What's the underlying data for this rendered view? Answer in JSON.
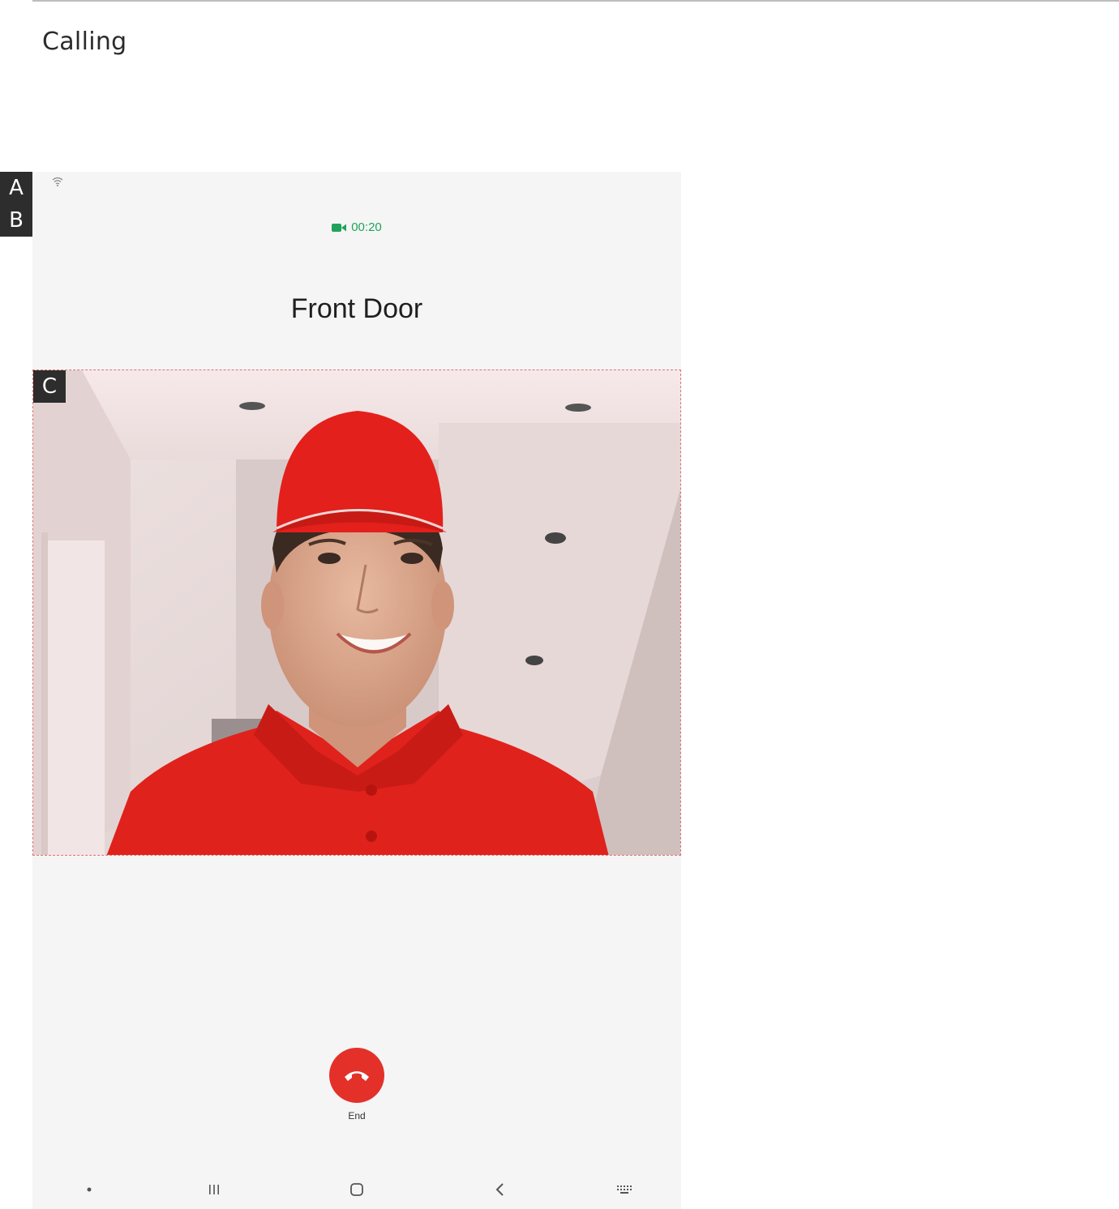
{
  "page": {
    "title": "Calling"
  },
  "badges": {
    "a": "A",
    "b": "B",
    "c": "C"
  },
  "call": {
    "timer": "00:20",
    "caller_name": "Front Door",
    "end_label": "End"
  },
  "colors": {
    "accent_green": "#1fa35a",
    "end_red": "#e3312a",
    "background": "#f5f5f5"
  },
  "navbar": {
    "items": [
      "dot-icon",
      "recents-icon",
      "home-icon",
      "back-icon",
      "keyboard-icon"
    ]
  }
}
